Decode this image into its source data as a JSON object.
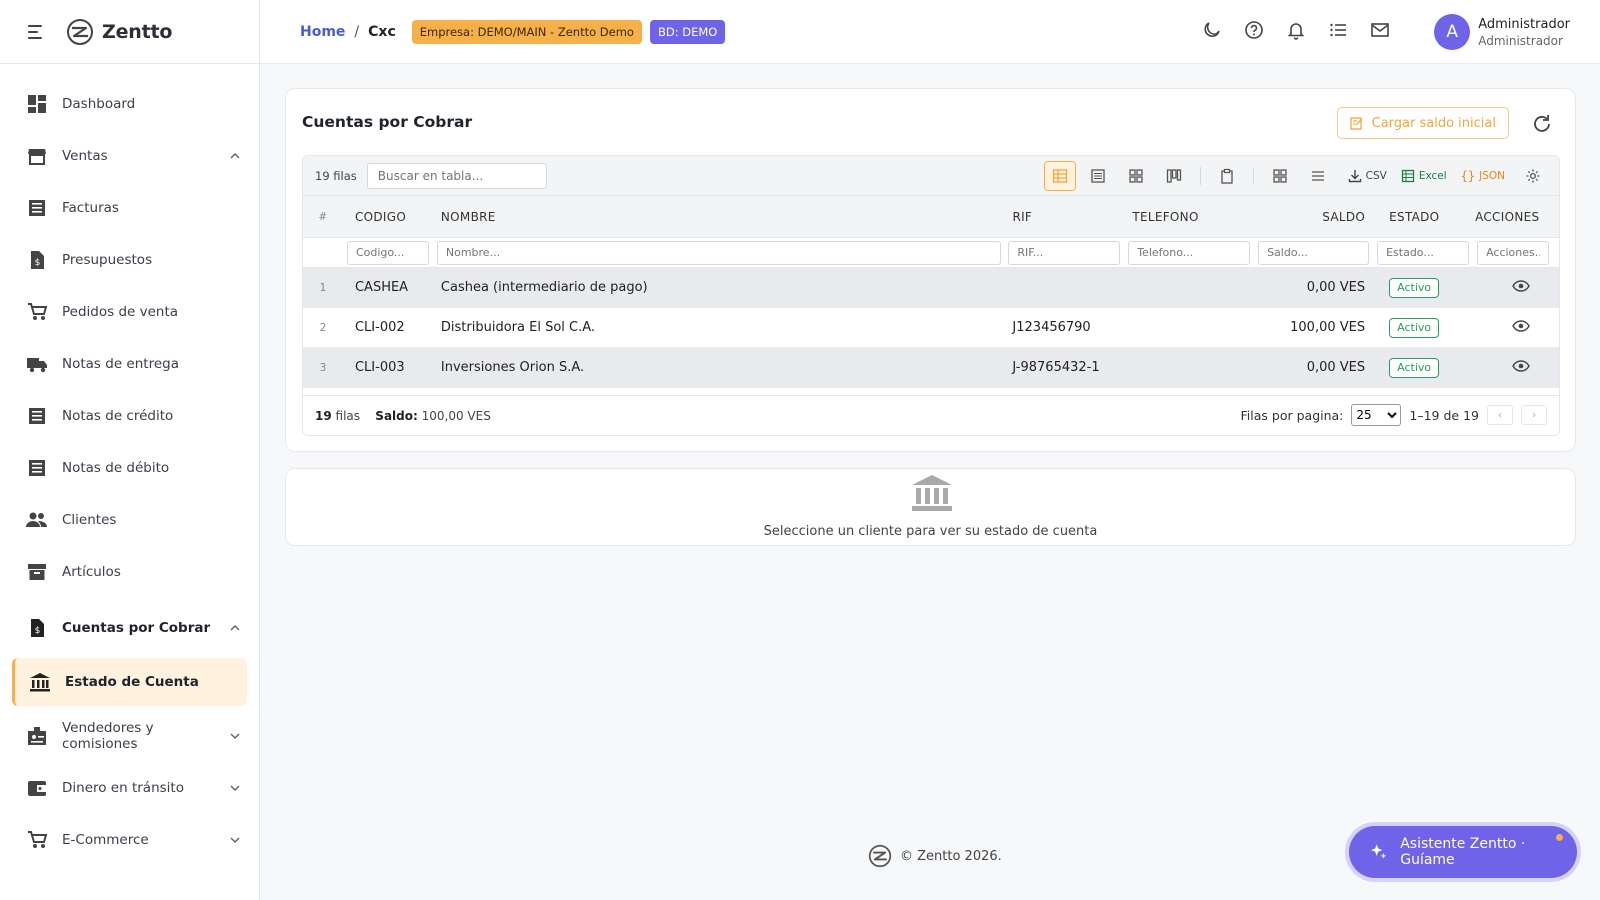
{
  "brand": {
    "name": "Zentto"
  },
  "sidebar": {
    "items": [
      {
        "label": "Dashboard"
      },
      {
        "label": "Ventas"
      },
      {
        "label": "Facturas"
      },
      {
        "label": "Presupuestos"
      },
      {
        "label": "Pedidos de venta"
      },
      {
        "label": "Notas de entrega"
      },
      {
        "label": "Notas de crédito"
      },
      {
        "label": "Notas de débito"
      },
      {
        "label": "Clientes"
      },
      {
        "label": "Artículos"
      },
      {
        "label": "Cuentas por Cobrar"
      },
      {
        "label": "Estado de Cuenta"
      },
      {
        "label": "Vendedores y comisiones"
      },
      {
        "label": "Dinero en tránsito"
      },
      {
        "label": "E-Commerce"
      }
    ]
  },
  "header": {
    "breadcrumb_home": "Home",
    "breadcrumb_sep": "/",
    "breadcrumb_current": "Cxc",
    "chip_empresa": "Empresa: DEMO/MAIN - Zentto Demo",
    "chip_bd": "BD: DEMO",
    "user_initial": "A",
    "user_name": "Administrador",
    "user_role": "Administrador"
  },
  "card": {
    "title": "Cuentas por Cobrar",
    "load_button": "Cargar saldo inicial"
  },
  "grid": {
    "rows_count": "19 filas",
    "search_placeholder": "Buscar en tabla...",
    "export_csv": "CSV",
    "export_excel": "Excel",
    "export_json": "JSON",
    "columns": [
      "#",
      "CODIGO",
      "NOMBRE",
      "RIF",
      "TELEFONO",
      "SALDO",
      "ESTADO",
      "ACCIONES"
    ],
    "filter_placeholders": [
      "Codigo...",
      "Nombre...",
      "RIF...",
      "Telefono...",
      "Saldo...",
      "Estado...",
      "Acciones..."
    ],
    "rows": [
      {
        "num": "1",
        "codigo": "CASHEA",
        "nombre": "Cashea (intermediario de pago)",
        "rif": "",
        "telefono": "",
        "saldo": "0,00 VES",
        "estado": "Activo"
      },
      {
        "num": "2",
        "codigo": "CLI-002",
        "nombre": "Distribuidora El Sol C.A.",
        "rif": "J123456790",
        "telefono": "",
        "saldo": "100,00 VES",
        "estado": "Activo"
      },
      {
        "num": "3",
        "codigo": "CLI-003",
        "nombre": "Inversiones Orion S.A.",
        "rif": "J-98765432-1",
        "telefono": "",
        "saldo": "0,00 VES",
        "estado": "Activo"
      }
    ],
    "footer_count": "19",
    "footer_count_suffix": "filas",
    "footer_saldo_label": "Saldo:",
    "footer_saldo_value": "100,00 VES",
    "rows_per_page_label": "Filas por pagina:",
    "rows_per_page_value": "25",
    "range": "1–19 de 19"
  },
  "empty_state": {
    "text": "Seleccione un cliente para ver su estado de cuenta"
  },
  "footer": {
    "copyright": "© Zentto 2026."
  },
  "assistant": {
    "label": "Asistente Zentto · Guíame"
  },
  "colors": {
    "accent_orange": "#f5b04a",
    "accent_purple": "#6f63e8",
    "status_green": "#2c9a62"
  }
}
